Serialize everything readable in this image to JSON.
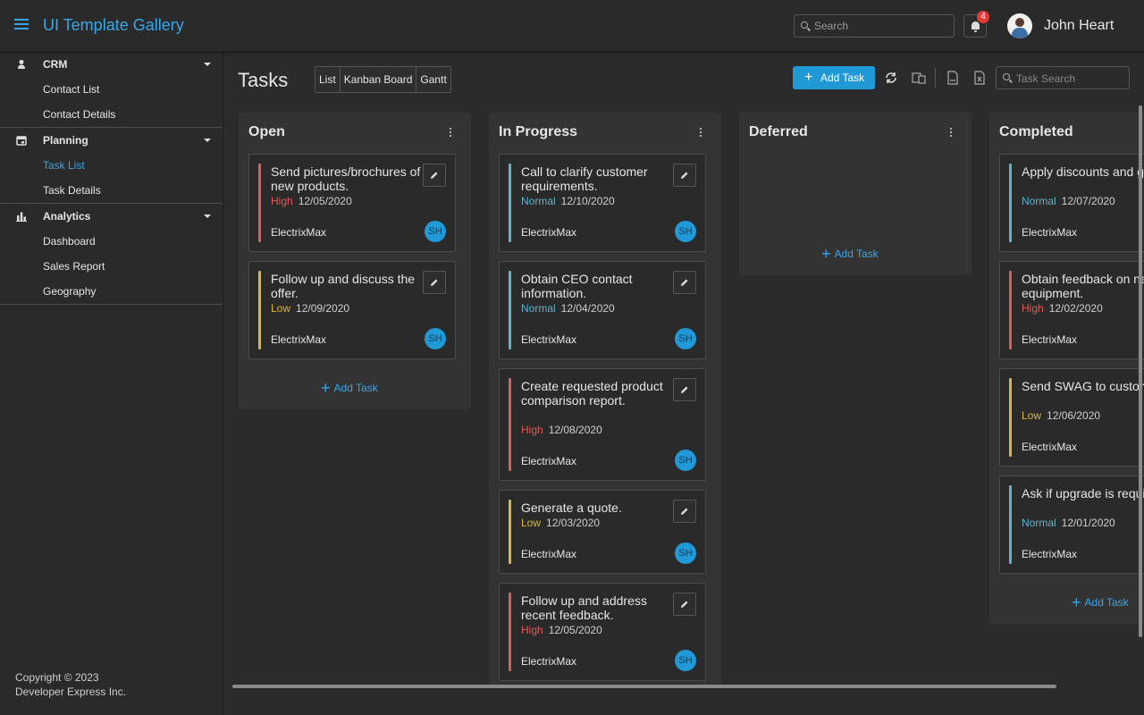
{
  "header": {
    "app_title": "UI Template Gallery",
    "search_placeholder": "Search",
    "notification_count": "4",
    "user_name": "John Heart"
  },
  "sidebar": {
    "groups": [
      {
        "label": "CRM",
        "icon": "user-icon",
        "items": [
          {
            "label": "Contact List"
          },
          {
            "label": "Contact Details"
          }
        ]
      },
      {
        "label": "Planning",
        "icon": "calendar-icon",
        "items": [
          {
            "label": "Task List",
            "active": true
          },
          {
            "label": "Task Details"
          }
        ]
      },
      {
        "label": "Analytics",
        "icon": "bar-chart-icon",
        "items": [
          {
            "label": "Dashboard"
          },
          {
            "label": "Sales Report"
          },
          {
            "label": "Geography"
          }
        ]
      }
    ],
    "copyright_line1": "Copyright © 2023",
    "copyright_line2": "Developer Express Inc."
  },
  "toolbar": {
    "page_title": "Tasks",
    "views": [
      "List",
      "Kanban Board",
      "Gantt"
    ],
    "add_task_label": "Add Task",
    "task_search_placeholder": "Task Search"
  },
  "colors": {
    "accent": "#1f9ad6",
    "priority_high": "#e05a5a",
    "priority_normal": "#5fb3cf",
    "priority_low": "#e0b43a"
  },
  "board": {
    "add_task_label": "Add Task",
    "columns": [
      {
        "title": "Open",
        "cards": [
          {
            "title": "Send pictures/brochures of new products.",
            "priority": "High",
            "date": "12/05/2020",
            "company": "ElectrixMax",
            "owner": "SH"
          },
          {
            "title": "Follow up and discuss the offer.",
            "priority": "Low",
            "date": "12/09/2020",
            "company": "ElectrixMax",
            "owner": "SH"
          }
        ]
      },
      {
        "title": "In Progress",
        "cards": [
          {
            "title": "Call to clarify customer requirements.",
            "priority": "Normal",
            "date": "12/10/2020",
            "company": "ElectrixMax",
            "owner": "SH"
          },
          {
            "title": "Obtain CEO contact information.",
            "priority": "Normal",
            "date": "12/04/2020",
            "company": "ElectrixMax",
            "owner": "SH"
          },
          {
            "title": "Create requested product comparison report.",
            "priority": "High",
            "date": "12/08/2020",
            "company": "ElectrixMax",
            "owner": "SH"
          },
          {
            "title": "Generate a quote.",
            "priority": "Low",
            "date": "12/03/2020",
            "company": "ElectrixMax",
            "owner": "SH"
          },
          {
            "title": "Follow up and address recent feedback.",
            "priority": "High",
            "date": "12/05/2020",
            "company": "ElectrixMax",
            "owner": "SH"
          }
        ]
      },
      {
        "title": "Deferred",
        "cards": []
      },
      {
        "title": "Completed",
        "cards": [
          {
            "title": "Apply discounts and generate a binding offer.",
            "priority": "Normal",
            "date": "12/07/2020",
            "company": "ElectrixMax",
            "owner": ""
          },
          {
            "title": "Obtain feedback on new equipment.",
            "priority": "High",
            "date": "12/02/2020",
            "company": "ElectrixMax",
            "owner": ""
          },
          {
            "title": "Send SWAG to customer.",
            "priority": "Low",
            "date": "12/06/2020",
            "company": "ElectrixMax",
            "owner": ""
          },
          {
            "title": "Ask if upgrade is required.",
            "priority": "Normal",
            "date": "12/01/2020",
            "company": "ElectrixMax",
            "owner": ""
          }
        ]
      }
    ]
  }
}
